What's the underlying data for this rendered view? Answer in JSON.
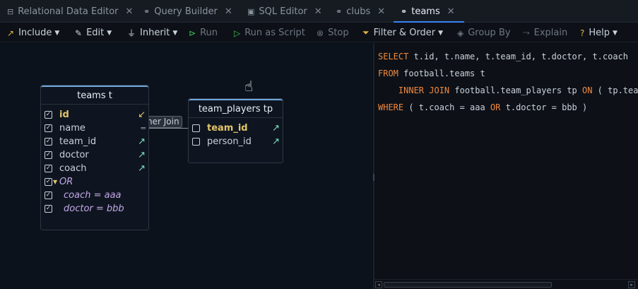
{
  "tabs": [
    {
      "label": "Relational Data Editor",
      "icon": "table-search-icon"
    },
    {
      "label": "Query Builder",
      "icon": "link-icon"
    },
    {
      "label": "SQL Editor",
      "icon": "terminal-icon"
    },
    {
      "label": "clubs",
      "icon": "link-icon"
    },
    {
      "label": "teams",
      "icon": "link-icon",
      "active": true
    }
  ],
  "close_glyph": "✕",
  "toolbar": {
    "include": "Include",
    "edit": "Edit",
    "inherit": "Inherit",
    "run": "Run",
    "run_script": "Run as Script",
    "stop": "Stop",
    "filter_order": "Filter & Order",
    "group_by": "Group By",
    "explain": "Explain",
    "help": "Help"
  },
  "entities": {
    "teams": {
      "title": "teams t",
      "rows": [
        {
          "label": "id",
          "checked": true,
          "pk": true
        },
        {
          "label": "name",
          "checked": true
        },
        {
          "label": "team_id",
          "checked": true
        },
        {
          "label": "doctor",
          "checked": true
        },
        {
          "label": "coach",
          "checked": true
        },
        {
          "label": "OR",
          "checked": true
        },
        {
          "label": "coach = aaa",
          "checked": true
        },
        {
          "label": "doctor = bbb",
          "checked": true
        }
      ]
    },
    "team_players": {
      "title": "team_players tp",
      "rows": [
        {
          "label": "team_id",
          "checked": false,
          "pk": true
        },
        {
          "label": "person_id",
          "checked": false
        }
      ]
    }
  },
  "join_label": "ner Join",
  "sql": {
    "line1_kw": "SELECT",
    "line1_rest": " t.id, t.name, t.team_id, t.doctor, t.coach",
    "line2_kw": "FROM",
    "line2_rest": " football.teams t",
    "line3_indent": "    ",
    "line3_kw": "INNER JOIN",
    "line3_mid": " football.team_players tp ",
    "line3_kw2": "ON",
    "line3_rest": " ( tp.team_id",
    "line4_kw": "WHERE",
    "line4_a": " ( t.coach = aaa ",
    "line4_kw2": "OR",
    "line4_b": " t.doctor = bbb )"
  },
  "colors": {
    "accent": "#3b82f6",
    "keyword": "#f0883e",
    "pk": "#e3c56a",
    "link_arrow": "#7ee2c0"
  }
}
